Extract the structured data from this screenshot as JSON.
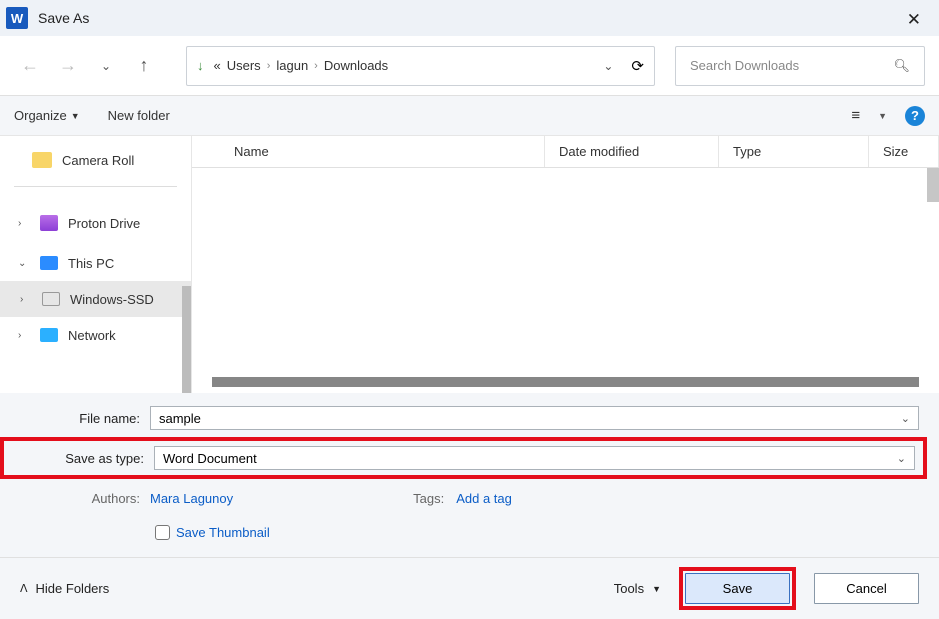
{
  "titlebar": {
    "title": "Save As"
  },
  "breadcrumb": {
    "prefix": "«",
    "parts": [
      "Users",
      "lagun",
      "Downloads"
    ]
  },
  "search": {
    "placeholder": "Search Downloads"
  },
  "toolbar": {
    "organize": "Organize",
    "new_folder": "New folder"
  },
  "sidebar": {
    "items": [
      {
        "label": "Camera Roll"
      },
      {
        "label": "Proton Drive"
      },
      {
        "label": "This PC"
      },
      {
        "label": "Windows-SSD"
      },
      {
        "label": "Network"
      }
    ]
  },
  "columns": {
    "name": "Name",
    "date": "Date modified",
    "type": "Type",
    "size": "Size"
  },
  "form": {
    "filename_label": "File name:",
    "filename_value": "sample",
    "savetype_label": "Save as type:",
    "savetype_value": "Word Document",
    "authors_label": "Authors:",
    "authors_value": "Mara Lagunoy",
    "tags_label": "Tags:",
    "tags_value": "Add a tag",
    "save_thumbnail": "Save Thumbnail"
  },
  "footer": {
    "hide_folders": "Hide Folders",
    "tools": "Tools",
    "save": "Save",
    "cancel": "Cancel"
  }
}
